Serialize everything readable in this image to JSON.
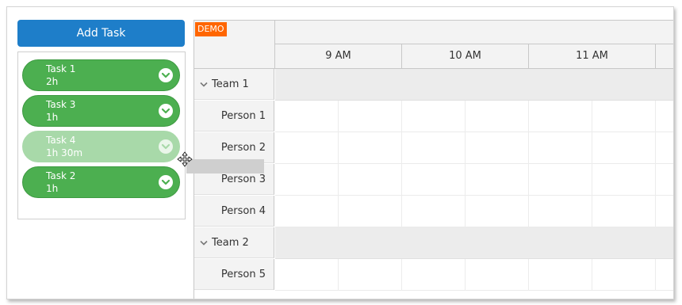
{
  "sidebar": {
    "add_task_label": "Add Task",
    "tasks": [
      {
        "name": "Task 1",
        "duration": "2h"
      },
      {
        "name": "Task 3",
        "duration": "1h"
      },
      {
        "name": "Task 4",
        "duration": "1h 30m"
      },
      {
        "name": "Task 2",
        "duration": "1h"
      }
    ]
  },
  "scheduler": {
    "demo_badge": "DEMO",
    "hours": [
      "9 AM",
      "10 AM",
      "11 AM"
    ],
    "rows": [
      {
        "label": "Team 1",
        "type": "team"
      },
      {
        "label": "Person 1",
        "type": "person"
      },
      {
        "label": "Person 2",
        "type": "person"
      },
      {
        "label": "Person 3",
        "type": "person"
      },
      {
        "label": "Person 4",
        "type": "person"
      },
      {
        "label": "Team 2",
        "type": "team"
      },
      {
        "label": "Person 5",
        "type": "person"
      }
    ]
  },
  "colors": {
    "accent": "#1e7ec9",
    "task_green": "#4caf50",
    "task_dragging": "#a8d9a9",
    "demo_badge": "#ff6600"
  }
}
